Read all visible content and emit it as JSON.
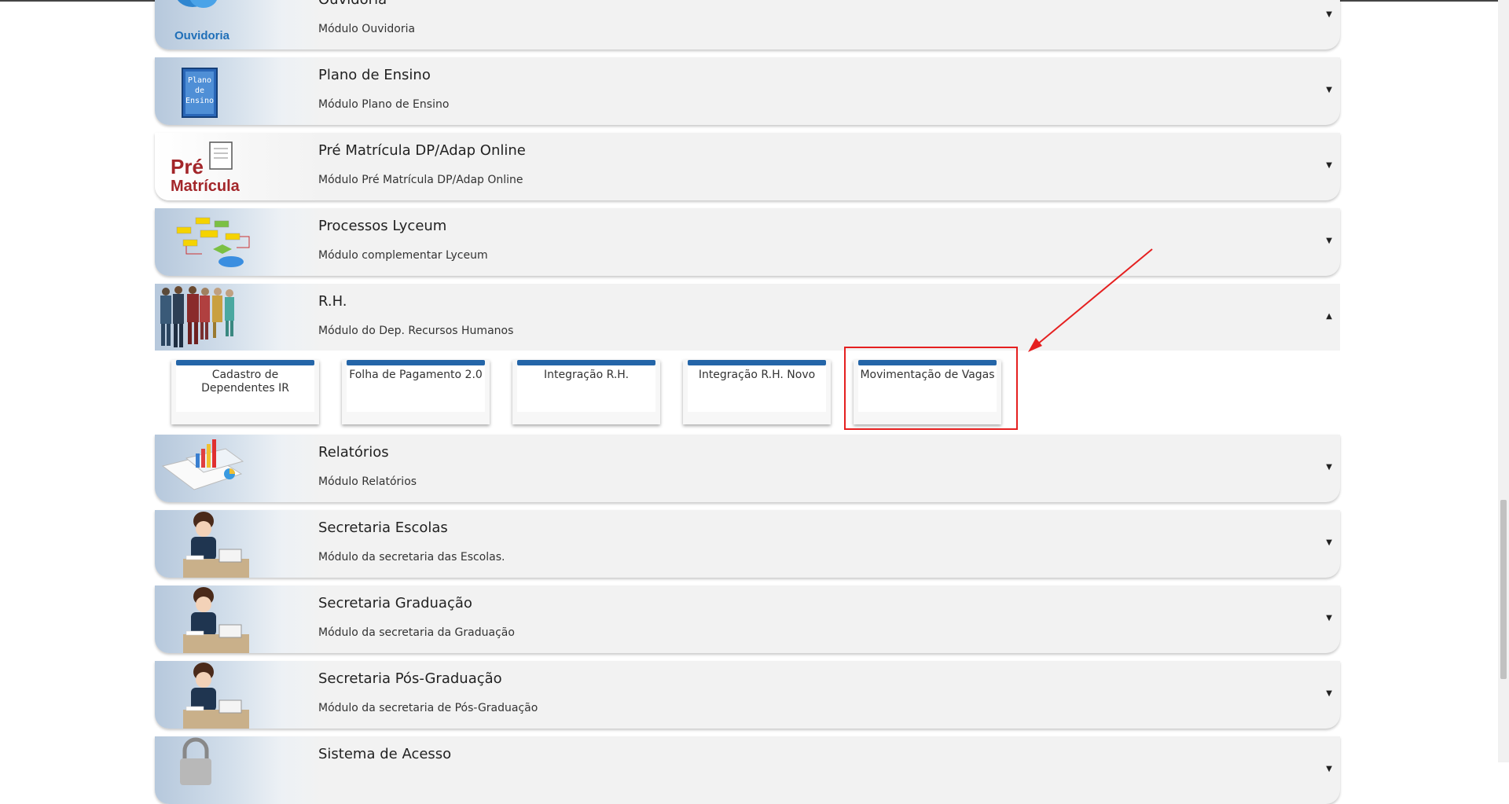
{
  "modules": [
    {
      "title": "Ouvidoria",
      "desc": "Módulo Ouvidoria",
      "icon": "ouvidoria-icon",
      "chevron": "▼",
      "logo_text": "Ouvidoria"
    },
    {
      "title": "Plano de Ensino",
      "desc": "Módulo Plano de Ensino",
      "icon": "plano-de-ensino-icon",
      "chevron": "▼",
      "logo_text": "Plano de Ensino"
    },
    {
      "title": "Pré Matrícula DP/Adap Online",
      "desc": "Módulo Pré Matrícula DP/Adap Online",
      "icon": "pre-matricula-icon",
      "chevron": "▼",
      "logo_text": "Pré Matrícula"
    },
    {
      "title": "Processos Lyceum",
      "desc": "Módulo complementar Lyceum",
      "icon": "flowchart-icon",
      "chevron": "▼"
    },
    {
      "title": "R.H.",
      "desc": "Módulo do Dep. Recursos Humanos",
      "icon": "people-icon",
      "chevron": "▲"
    },
    {
      "title": "Relatórios",
      "desc": "Módulo Relatórios",
      "icon": "reports-icon",
      "chevron": "▼"
    },
    {
      "title": "Secretaria Escolas",
      "desc": "Módulo da secretaria das Escolas.",
      "icon": "secretary-icon",
      "chevron": "▼"
    },
    {
      "title": "Secretaria Graduação",
      "desc": "Módulo da secretaria da Graduação",
      "icon": "secretary-icon",
      "chevron": "▼"
    },
    {
      "title": "Secretaria Pós-Graduação",
      "desc": "Módulo da secretaria de Pós-Graduação",
      "icon": "secretary-icon",
      "chevron": "▼"
    },
    {
      "title": "Sistema de Acesso",
      "desc": "",
      "icon": "lock-icon",
      "chevron": "▼"
    }
  ],
  "rh_submodules": [
    {
      "label": "Cadastro de Dependentes IR"
    },
    {
      "label": "Folha de Pagamento 2.0"
    },
    {
      "label": "Integração R.H."
    },
    {
      "label": "Integração R.H. Novo"
    },
    {
      "label": "Movimentação de Vagas"
    }
  ],
  "colors": {
    "card_bar": "#2465a8",
    "highlight": "#e52020",
    "module_bg": "#f2f2f2",
    "pre_matricula_red": "#a3262a"
  }
}
